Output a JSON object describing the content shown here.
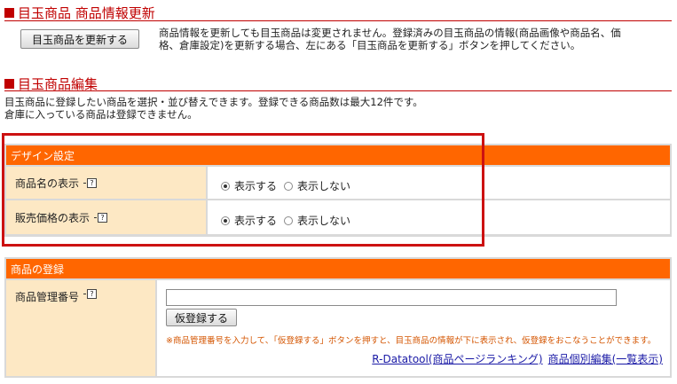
{
  "update_section": {
    "title": "目玉商品 商品情報更新",
    "button_label": "目玉商品を更新する",
    "note_line1": "商品情報を更新しても目玉商品は変更されません。登録済みの目玉商品の情報(商品画像や商品名、価",
    "note_line2": "格、倉庫設定)を更新する場合、左にある「目玉商品を更新する」ボタンを押してください。"
  },
  "edit_section": {
    "title": "目玉商品編集",
    "desc_line1": "目玉商品に登録したい商品を選択・並び替えできます。登録できる商品数は最大12件です。",
    "desc_line2": "倉庫に入っている商品は登録できません。"
  },
  "design_panel": {
    "header": "デザイン設定",
    "rows": [
      {
        "label": "商品名の表示",
        "help": "?",
        "options": [
          "表示する",
          "表示しない"
        ],
        "selected": "表示する"
      },
      {
        "label": "販売価格の表示",
        "help": "?",
        "options": [
          "表示する",
          "表示しない"
        ],
        "selected": "表示する"
      }
    ]
  },
  "register_panel": {
    "header": "商品の登録",
    "label": "商品管理番号",
    "help": "?",
    "input_value": "",
    "button_label": "仮登録する",
    "hint": "※商品管理番号を入力して、「仮登録する」ボタンを押すと、目玉商品の情報が下に表示され、仮登録をおこなうことができます。",
    "links": [
      "R-Datatool(商品ページランキング)",
      "商品個別編集(一覧表示)"
    ]
  },
  "colors": {
    "accent_red": "#c00000",
    "header_orange": "#ff6600",
    "label_bg": "#fde8c4",
    "highlight_frame": "#cc1111"
  }
}
